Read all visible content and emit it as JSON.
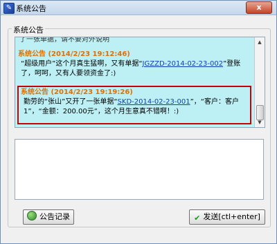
{
  "window": {
    "title": "系统公告",
    "close_label": "x",
    "app_icon": "notice-app-icon"
  },
  "group": {
    "title": "系统公告"
  },
  "feed": {
    "cut_line": "了一张单据，请不要对外说明",
    "messages": [
      {
        "header": "系统公告 (2014/2/23 19:12:46)",
        "text_before": "“超级用户”这个月真生猛啊，又有单据“",
        "link": "JGZZD-2014-02-23-002",
        "text_after": "”登账了，呵呵，又有人要领资金了:)"
      },
      {
        "header": "系统公告 (2014/2/23 19:19:26)",
        "text_before": "勤劳的“张山”又开了一张单据“",
        "link": "SKD-2014-02-23-001",
        "text_after": "”，“客户：客户1”，“金额：200.00元”，这个月生意真不错啊！:)"
      }
    ]
  },
  "buttons": {
    "records_label": "公告记录",
    "send_label": "发送[ctl+enter]"
  },
  "icons": {
    "records": "globe-icon",
    "send": "checkmark-icon"
  }
}
